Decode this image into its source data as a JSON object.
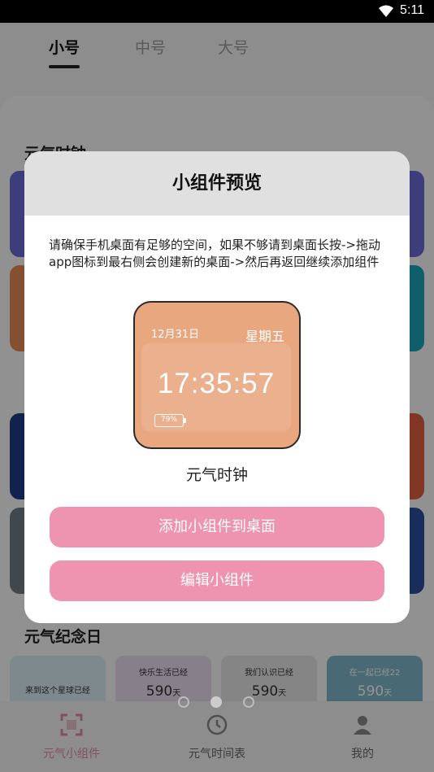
{
  "status_bar": {
    "time": "5:11"
  },
  "size_tabs": [
    {
      "label": "小号",
      "active": true
    },
    {
      "label": "中号",
      "active": false
    },
    {
      "label": "大号",
      "active": false
    }
  ],
  "sections": {
    "clock_title": "元气时钟",
    "memorial_title": "元气纪念日"
  },
  "memorial_cards": [
    {
      "text": "来到这个星球已经",
      "number": "",
      "unit": ""
    },
    {
      "text": "快乐生活已经",
      "number": "590",
      "unit": "天"
    },
    {
      "text": "我们认识已经",
      "number": "590",
      "unit": "天"
    },
    {
      "text": "在一起已经22",
      "number": "590",
      "unit": "天"
    }
  ],
  "dialog": {
    "title": "小组件预览",
    "message": "请确保手机桌面有足够的空间，如果不够请到桌面长按->拖动app图标到最右侧会创建新的桌面->然后再返回继续添加组件",
    "widget": {
      "date": "12月31日",
      "weekday": "星期五",
      "time": "17:35:57",
      "battery": "79%"
    },
    "widget_name": "元气时钟",
    "add_button": "添加小组件到桌面",
    "edit_button": "编辑小组件"
  },
  "pager": {
    "count": 3,
    "active_index": 1
  },
  "bottom_nav": [
    {
      "label": "元气小组件",
      "icon": "widget-scan-icon",
      "active": true
    },
    {
      "label": "元气时间表",
      "icon": "clock-timer-icon",
      "active": false
    },
    {
      "label": "我的",
      "icon": "person-icon",
      "active": false
    }
  ],
  "colors": {
    "accent_pink": "#ee93b0",
    "widget_peach": "#e9a77f",
    "active_nav": "#e08ba6"
  }
}
